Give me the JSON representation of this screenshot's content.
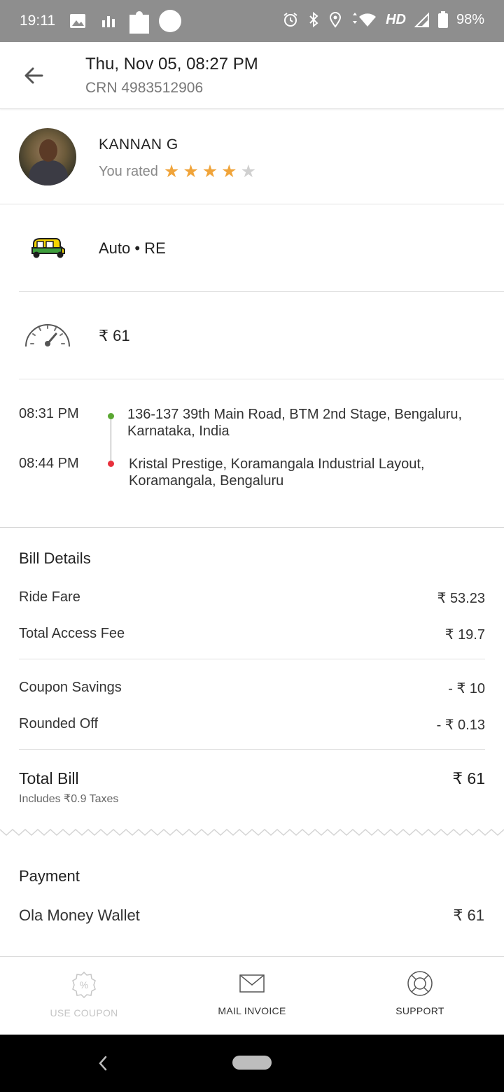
{
  "status_bar": {
    "time": "19:11",
    "network_label": "HD",
    "battery": "98%"
  },
  "header": {
    "title": "Thu, Nov 05, 08:27 PM",
    "crn": "CRN 4983512906"
  },
  "driver": {
    "name": "KANNAN G",
    "rated_label": "You rated",
    "rating": 4,
    "max_rating": 5
  },
  "vehicle": {
    "label": "Auto • RE"
  },
  "fare": {
    "amount": "₹ 61"
  },
  "route": {
    "pickup_time": "08:31 PM",
    "pickup_address": "136-137 39th Main Road, BTM 2nd Stage, Bengaluru, Karnataka, India",
    "drop_time": "08:44 PM",
    "drop_address": "Kristal Prestige, Koramangala Industrial Layout, Koramangala, Bengaluru"
  },
  "bill": {
    "heading": "Bill Details",
    "ride_fare_label": "Ride Fare",
    "ride_fare_value": "₹ 53.23",
    "access_fee_label": "Total Access Fee",
    "access_fee_value": "₹ 19.7",
    "coupon_label": "Coupon Savings",
    "coupon_value": "- ₹ 10",
    "rounded_label": "Rounded Off",
    "rounded_value": "- ₹ 0.13",
    "total_label": "Total Bill",
    "total_value": "₹ 61",
    "taxes_note": "Includes ₹0.9 Taxes"
  },
  "payment": {
    "heading": "Payment",
    "method": "Ola Money Wallet",
    "amount": "₹ 61"
  },
  "actions": {
    "use_coupon": "USE COUPON",
    "mail_invoice": "MAIL INVOICE",
    "support": "SUPPORT"
  },
  "colors": {
    "star_on": "#f0a43a",
    "star_off": "#d0d0d0",
    "pickup_dot": "#5aa732",
    "drop_dot": "#e8303c",
    "status_bar": "#8e8e8e"
  },
  "icons": [
    "gallery-icon",
    "bar-chart-icon",
    "puzzle-icon",
    "circle-icon",
    "alarm-icon",
    "bluetooth-icon",
    "location-icon",
    "wifi-icon",
    "signal-icon",
    "battery-icon",
    "back-arrow-icon",
    "star-icon",
    "auto-rickshaw-icon",
    "speedometer-icon",
    "coupon-icon",
    "mail-icon",
    "support-icon",
    "nav-back-icon",
    "nav-home-pill"
  ]
}
